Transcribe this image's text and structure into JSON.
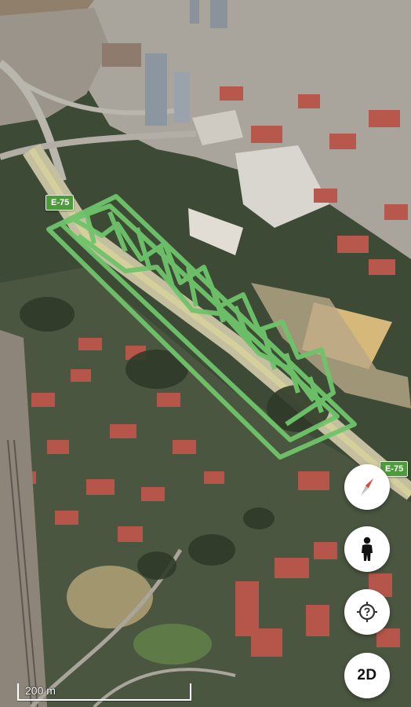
{
  "map": {
    "road_label_top": "E-75",
    "road_label_right": "E-75",
    "overlay_color": "#6fc46a",
    "scale": {
      "label": "200 m"
    }
  },
  "controls": {
    "compass": {
      "icon": "compass-icon"
    },
    "street_view": {
      "icon": "pegman-icon"
    },
    "my_location": {
      "icon": "location-target-icon"
    },
    "view_mode": {
      "label": "2D"
    }
  }
}
